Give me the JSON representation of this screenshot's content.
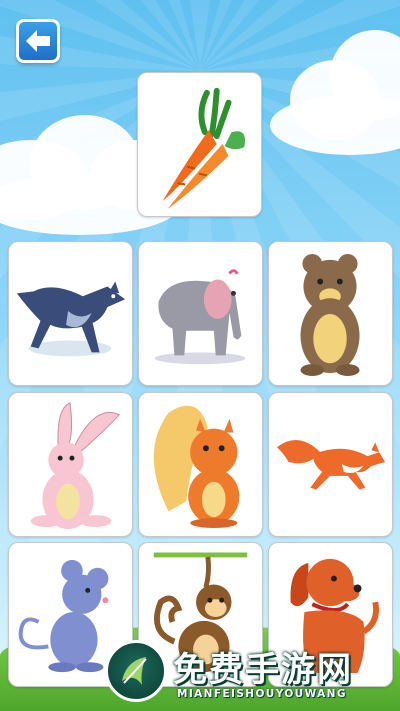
{
  "screen": "match-the-picture",
  "back_button": {
    "icon": "arrow-left-icon"
  },
  "target_card": {
    "subject": "carrot"
  },
  "answer_grid": [
    {
      "subject": "wolf"
    },
    {
      "subject": "elephant"
    },
    {
      "subject": "bear"
    },
    {
      "subject": "rabbit"
    },
    {
      "subject": "squirrel"
    },
    {
      "subject": "fox"
    },
    {
      "subject": "mouse"
    },
    {
      "subject": "monkey"
    },
    {
      "subject": "dog"
    }
  ],
  "watermark": {
    "title": "免费手游网",
    "subtitle": "MIANFEISHOUYOUWANG"
  },
  "colors": {
    "sky": "#5fc0f0",
    "grass": "#4ea62b",
    "back_button": "#1d6fc6",
    "card_border": "#c7c7c7"
  }
}
